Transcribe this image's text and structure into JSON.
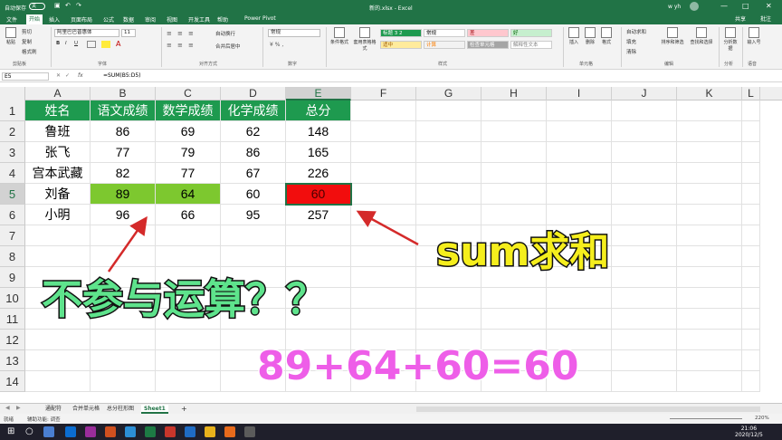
{
  "titlebar": {
    "autosave": "自动保存",
    "toggle": "关",
    "doc_title": "新的.xlsx - Excel",
    "user": "w yh",
    "min": "—",
    "max": "□",
    "close": "✕"
  },
  "menu": {
    "items": [
      "文件",
      "开始",
      "插入",
      "页面布局",
      "公式",
      "数据",
      "审阅",
      "视图",
      "开发工具",
      "帮助",
      "Power Pivot"
    ],
    "share": "共享",
    "comment": "批注"
  },
  "ribbon": {
    "clipboard": {
      "cut": "剪切",
      "copy": "复制",
      "format_painter": "格式刷",
      "paste": "粘贴",
      "label": "剪贴板"
    },
    "font": {
      "name": "阿里巴巴普惠体",
      "size": "11",
      "bold": "B",
      "italic": "I",
      "underline": "U",
      "label": "字体"
    },
    "alignment": {
      "wrap": "自动换行",
      "merge": "合并后居中",
      "label": "对齐方式"
    },
    "number": {
      "format": "常规",
      "label": "数字"
    },
    "styles": {
      "conditional": "条件格式",
      "table": "套用表格格式",
      "cells": [
        {
          "text": "标题 3 2",
          "color": "#1e9a4f",
          "fg": "#ffffff"
        },
        {
          "text": "常规",
          "color": "#ffffff",
          "fg": "#000000"
        },
        {
          "text": "差",
          "color": "#ffc7ce",
          "fg": "#9c0006"
        },
        {
          "text": "好",
          "color": "#c6efce",
          "fg": "#006100"
        },
        {
          "text": "适中",
          "color": "#ffeb9c",
          "fg": "#9c5700"
        },
        {
          "text": "计算",
          "color": "#f2f2f2",
          "fg": "#fa7d00"
        },
        {
          "text": "检查单元格",
          "color": "#a5a5a5",
          "fg": "#ffffff"
        },
        {
          "text": "解释性文本",
          "color": "#ffffff",
          "fg": "#7f7f7f"
        }
      ],
      "label": "样式"
    },
    "cells_group": {
      "insert": "插入",
      "delete": "删除",
      "format": "格式",
      "label": "单元格"
    },
    "editing": {
      "autosum": "自动求和",
      "fill": "填充",
      "clear": "清除",
      "sort": "排序和筛选",
      "find": "查找和选择",
      "label": "编辑"
    },
    "analysis": {
      "analyze": "分析数据",
      "label": "分析"
    },
    "voice": {
      "dictate": "输入号",
      "label": "语音"
    }
  },
  "formula_bar": {
    "namebox": "E5",
    "fx": "fx",
    "formula": "=SUM(B5:D5)"
  },
  "grid": {
    "columns": [
      "A",
      "B",
      "C",
      "D",
      "E",
      "F",
      "G",
      "H",
      "I",
      "J",
      "K",
      "L"
    ],
    "rows": [
      "1",
      "2",
      "3",
      "4",
      "5",
      "6",
      "7",
      "8",
      "9",
      "10",
      "11",
      "12",
      "13",
      "14"
    ],
    "data": [
      [
        "姓名",
        "语文成绩",
        "数学成绩",
        "化学成绩",
        "总分"
      ],
      [
        "鲁班",
        "86",
        "69",
        "62",
        "148"
      ],
      [
        "张飞",
        "77",
        "79",
        "86",
        "165"
      ],
      [
        "宫本武藏",
        "82",
        "77",
        "67",
        "226"
      ],
      [
        "刘备",
        "89",
        "64",
        "60",
        "60"
      ],
      [
        "小明",
        "96",
        "66",
        "95",
        "257"
      ]
    ],
    "selected_cell": "E5"
  },
  "colors": {
    "excel_green": "#217346",
    "header_fill": "#1e9a4f",
    "text_number_fill": "#7dc82f",
    "error_fill": "#f20d0d",
    "annotation_arrow": "#d42a2a"
  },
  "overlay": {
    "not_calculated": "不参与运算？？",
    "sum_label": "sum求和",
    "equation": "89+64+60=60"
  },
  "sheets": {
    "tabs": [
      "通配符",
      "合并单元格",
      "总分柱形图",
      "Sheet1"
    ],
    "active": "Sheet1",
    "add": "+"
  },
  "status": {
    "ready": "就绪",
    "accessibility": "辅助功能: 调查",
    "zoom": "220%"
  },
  "taskbar": {
    "time": "21:06",
    "date": "2020/12/5"
  }
}
